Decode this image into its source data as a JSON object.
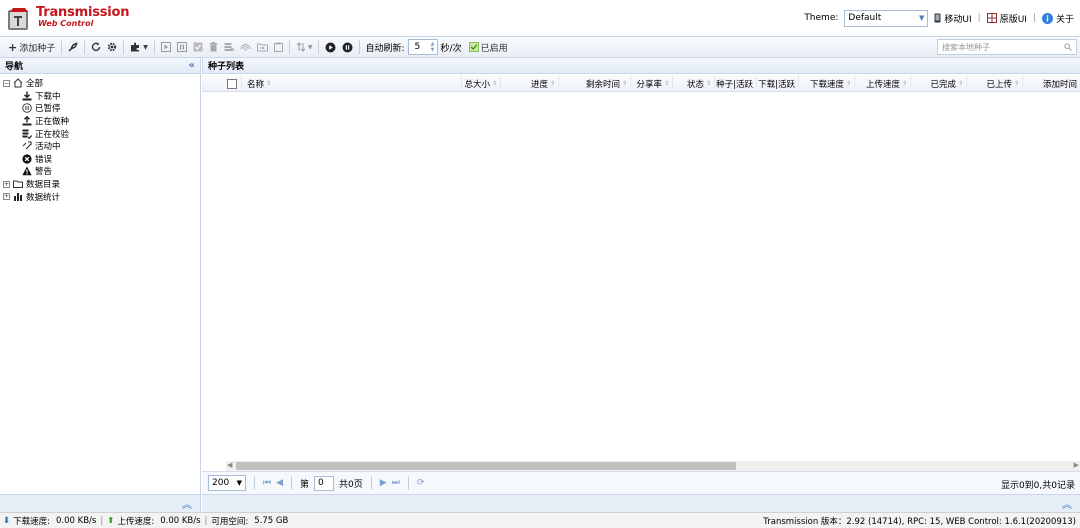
{
  "header": {
    "app_title": "Transmission",
    "app_subtitle": "Web Control",
    "theme_label": "Theme:",
    "theme_value": "Default",
    "links": [
      "移动UI",
      "原版UI",
      "关于"
    ]
  },
  "toolbar": {
    "add_torrent": "添加种子",
    "auto_refresh_label": "自动刷新:",
    "refresh_interval": "5",
    "refresh_unit": "秒/次",
    "enabled_label": "已启用",
    "search_placeholder": "搜索本地种子"
  },
  "nav": {
    "title": "导航",
    "items": [
      {
        "label": "全部",
        "icon": "home-icon"
      },
      {
        "label": "下载中",
        "icon": "download-icon"
      },
      {
        "label": "已暂停",
        "icon": "pause-icon"
      },
      {
        "label": "正在做种",
        "icon": "seed-icon"
      },
      {
        "label": "正在校验",
        "icon": "check-icon"
      },
      {
        "label": "活动中",
        "icon": "active-icon"
      },
      {
        "label": "错误",
        "icon": "error-icon"
      },
      {
        "label": "警告",
        "icon": "warning-icon"
      },
      {
        "label": "数据目录",
        "icon": "folder-icon"
      },
      {
        "label": "数据统计",
        "icon": "stats-icon"
      }
    ]
  },
  "list": {
    "title": "种子列表",
    "columns": [
      "名称",
      "总大小",
      "进度",
      "剩余时间",
      "分享率",
      "状态",
      "种子|活跃",
      "下载|活跃",
      "下载速度",
      "上传速度",
      "已完成",
      "已上传",
      "添加时间"
    ],
    "page_size": "200",
    "page_prefix": "第",
    "page_value": "0",
    "page_total": "共0页",
    "info": "显示0到0,共0记录"
  },
  "status": {
    "download_label": "下载速度:",
    "download_value": "0.00 KB/s",
    "upload_label": "上传速度:",
    "upload_value": "0.00 KB/s",
    "free_label": "可用空间:",
    "free_value": "5.75 GB",
    "version": "Transmission 版本：2.92 (14714), RPC: 15, WEB Control: 1.6.1(20200913)"
  },
  "colors": {
    "brand": "#c4161c",
    "accent": "#4a7ebb",
    "border": "#c9d6e8"
  }
}
